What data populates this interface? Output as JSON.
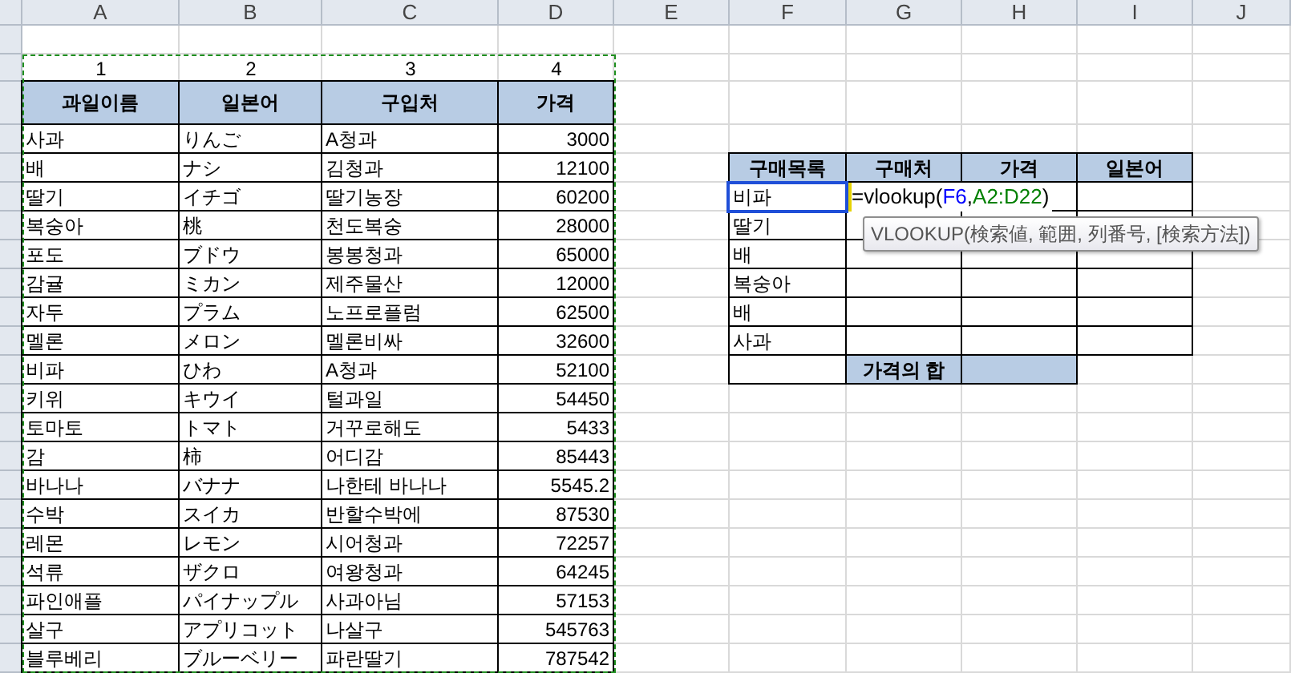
{
  "columns": [
    "A",
    "B",
    "C",
    "D",
    "E",
    "F",
    "G",
    "H",
    "I",
    "J"
  ],
  "price_table": {
    "index_row": [
      "1",
      "2",
      "3",
      "4"
    ],
    "headers": [
      "과일이름",
      "일본어",
      "구입처",
      "가격"
    ],
    "rows": [
      [
        "사과",
        "りんご",
        "A청과",
        "3000"
      ],
      [
        "배",
        "ナシ",
        "김청과",
        "12100"
      ],
      [
        "딸기",
        "イチゴ",
        "딸기농장",
        "60200"
      ],
      [
        "복숭아",
        "桃",
        "천도복숭",
        "28000"
      ],
      [
        "포도",
        "ブドウ",
        "봉봉청과",
        "65000"
      ],
      [
        "감귤",
        "ミカン",
        "제주물산",
        "12000"
      ],
      [
        "자두",
        "プラム",
        "노프로플럼",
        "62500"
      ],
      [
        "멜론",
        "メロン",
        "멜론비싸",
        "32600"
      ],
      [
        "비파",
        "ひわ",
        "A청과",
        "52100"
      ],
      [
        "키위",
        "キウイ",
        "털과일",
        "54450"
      ],
      [
        "토마토",
        "トマト",
        "거꾸로해도",
        "5433"
      ],
      [
        "감",
        "柿",
        "어디감",
        "85443"
      ],
      [
        "바나나",
        "バナナ",
        "나한테 바나나",
        "5545.2"
      ],
      [
        "수박",
        "スイカ",
        "반할수박에",
        "87530"
      ],
      [
        "레몬",
        "レモン",
        "시어청과",
        "72257"
      ],
      [
        "석류",
        "ザクロ",
        "여왕청과",
        "64245"
      ],
      [
        "파인애플",
        "パイナップル",
        "사과아님",
        "57153"
      ],
      [
        "살구",
        "アプリコット",
        "나살구",
        "545763"
      ],
      [
        "블루베리",
        "ブルーベリー",
        "파란딸기",
        "787542"
      ]
    ]
  },
  "purchase_table": {
    "headers": [
      "구매목록",
      "구매처",
      "가격",
      "일본어"
    ],
    "rows": [
      {
        "item": "비파",
        "selected": true
      },
      {
        "item": "딸기",
        "selected": false
      },
      {
        "item": "배",
        "selected": false
      },
      {
        "item": "복숭아",
        "selected": false
      },
      {
        "item": "배",
        "selected": false
      },
      {
        "item": "사과",
        "selected": false
      }
    ],
    "formula": {
      "prefix": "=vlookup(",
      "refs": [
        {
          "text": "F6",
          "color": "#0000ff"
        },
        {
          "text": "A2:D22",
          "color": "#008000"
        }
      ],
      "separator": ",",
      "suffix": ")"
    },
    "total_label": "가격의 합"
  },
  "tooltip": "VLOOKUP(検索値, 範囲, 列番号, [検索方法])"
}
